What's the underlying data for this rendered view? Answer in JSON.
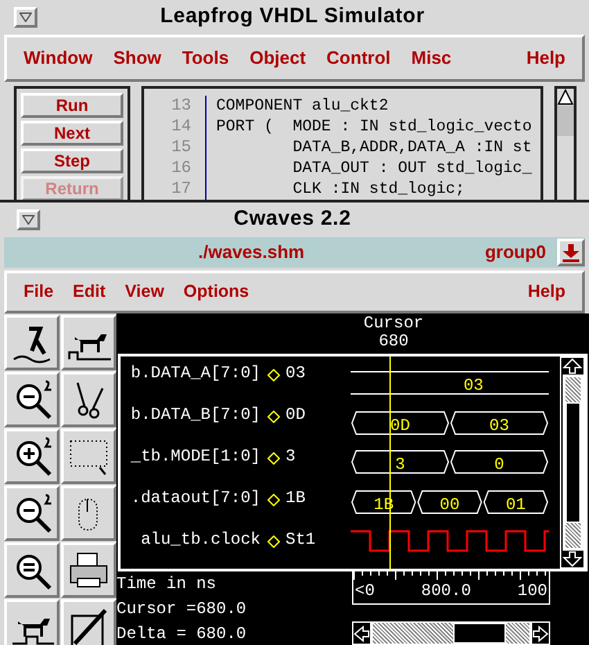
{
  "simulator": {
    "title": "Leapfrog VHDL Simulator",
    "menu": [
      "Window",
      "Show",
      "Tools",
      "Object",
      "Control",
      "Misc"
    ],
    "help": "Help",
    "buttons": [
      {
        "label": "Run",
        "disabled": false
      },
      {
        "label": "Next",
        "disabled": false
      },
      {
        "label": "Step",
        "disabled": false
      },
      {
        "label": "Return",
        "disabled": true
      }
    ],
    "code": [
      {
        "number": "13",
        "text": "COMPONENT alu_ckt2"
      },
      {
        "number": "14",
        "text": "PORT (  MODE : IN std_logic_vecto"
      },
      {
        "number": "15",
        "text": "        DATA_B,ADDR,DATA_A :IN st"
      },
      {
        "number": "16",
        "text": "        DATA_OUT : OUT std_logic_"
      },
      {
        "number": "17",
        "text": "        CLK :IN std_logic;"
      }
    ]
  },
  "cwaves": {
    "title": "Cwaves 2.2",
    "file": "./waves.shm",
    "group": "group0",
    "menu": [
      "File",
      "Edit",
      "View",
      "Options"
    ],
    "help": "Help",
    "cursor_label": "Cursor",
    "cursor_value": "680",
    "signals": [
      {
        "name": "b.DATA_A[7:0]",
        "value": "03",
        "kind": "bus",
        "segments": [
          "03"
        ]
      },
      {
        "name": "b.DATA_B[7:0]",
        "value": "0D",
        "kind": "bus",
        "segments": [
          "0D",
          "03"
        ]
      },
      {
        "name": "_tb.MODE[1:0]",
        "value": "3",
        "kind": "bus",
        "segments": [
          "3",
          "0"
        ]
      },
      {
        "name": ".dataout[7:0]",
        "value": "1B",
        "kind": "bus",
        "segments": [
          "1B",
          "00",
          "01"
        ]
      },
      {
        "name": "alu_tb.clock",
        "value": "St1",
        "kind": "clock"
      }
    ],
    "time_unit": "Time in ns",
    "cursor": "Cursor =680.0",
    "delta": "Delta = 680.0",
    "ruler": [
      "<0",
      "800.0",
      "100"
    ]
  }
}
